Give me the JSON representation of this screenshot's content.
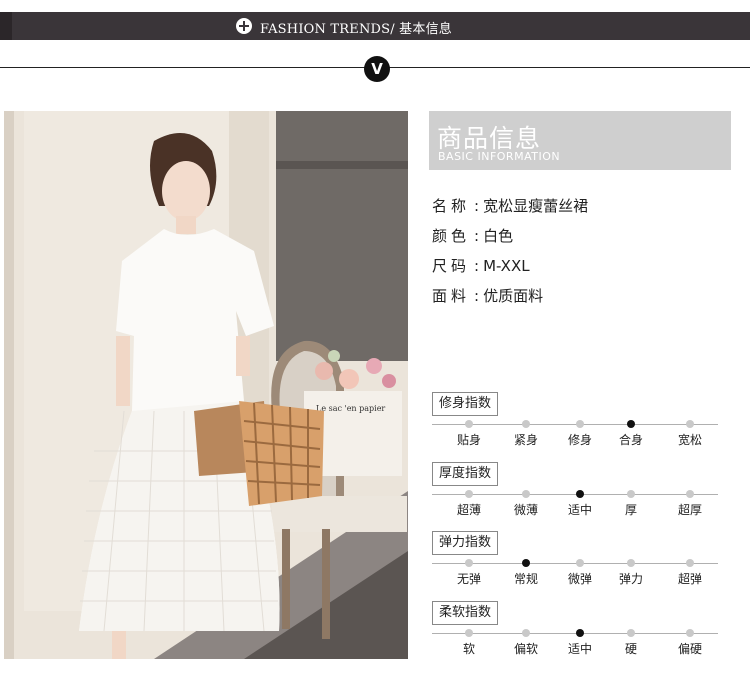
{
  "header": {
    "title": "FASHION TRENDS/  基本信息",
    "plus_icon": "plus-circle-icon",
    "badge_icon": "chevron-v-icon",
    "badge_text": "V"
  },
  "info": {
    "title_cn": "商品信息",
    "title_en": "BASIC INFORMATION"
  },
  "specs": [
    {
      "key": "名称",
      "value": "宽松显瘦蕾丝裙"
    },
    {
      "key": "颜色",
      "value": "白色"
    },
    {
      "key": "尺码",
      "value": "M-XXL"
    },
    {
      "key": "面料",
      "value": "优质面料"
    }
  ],
  "photo": {
    "bag_text_1": "Le sac 'en papier",
    "icon": "product-photo"
  },
  "meters": [
    {
      "label": "修身指数",
      "options": [
        "贴身",
        "紧身",
        "修身",
        "合身",
        "宽松"
      ],
      "selected": 3
    },
    {
      "label": "厚度指数",
      "options": [
        "超薄",
        "微薄",
        "适中",
        "厚",
        "超厚"
      ],
      "selected": 2
    },
    {
      "label": "弹力指数",
      "options": [
        "无弹",
        "常规",
        "微弹",
        "弹力",
        "超弹"
      ],
      "selected": 1
    },
    {
      "label": "柔软指数",
      "options": [
        "软",
        "偏软",
        "适中",
        "硬",
        "偏硬"
      ],
      "selected": 2
    }
  ],
  "colors": {
    "bar": "#3a3539",
    "accent": "#111111",
    "dot_off": "#c9c9c9",
    "head_bg": "#cfcfcf"
  }
}
